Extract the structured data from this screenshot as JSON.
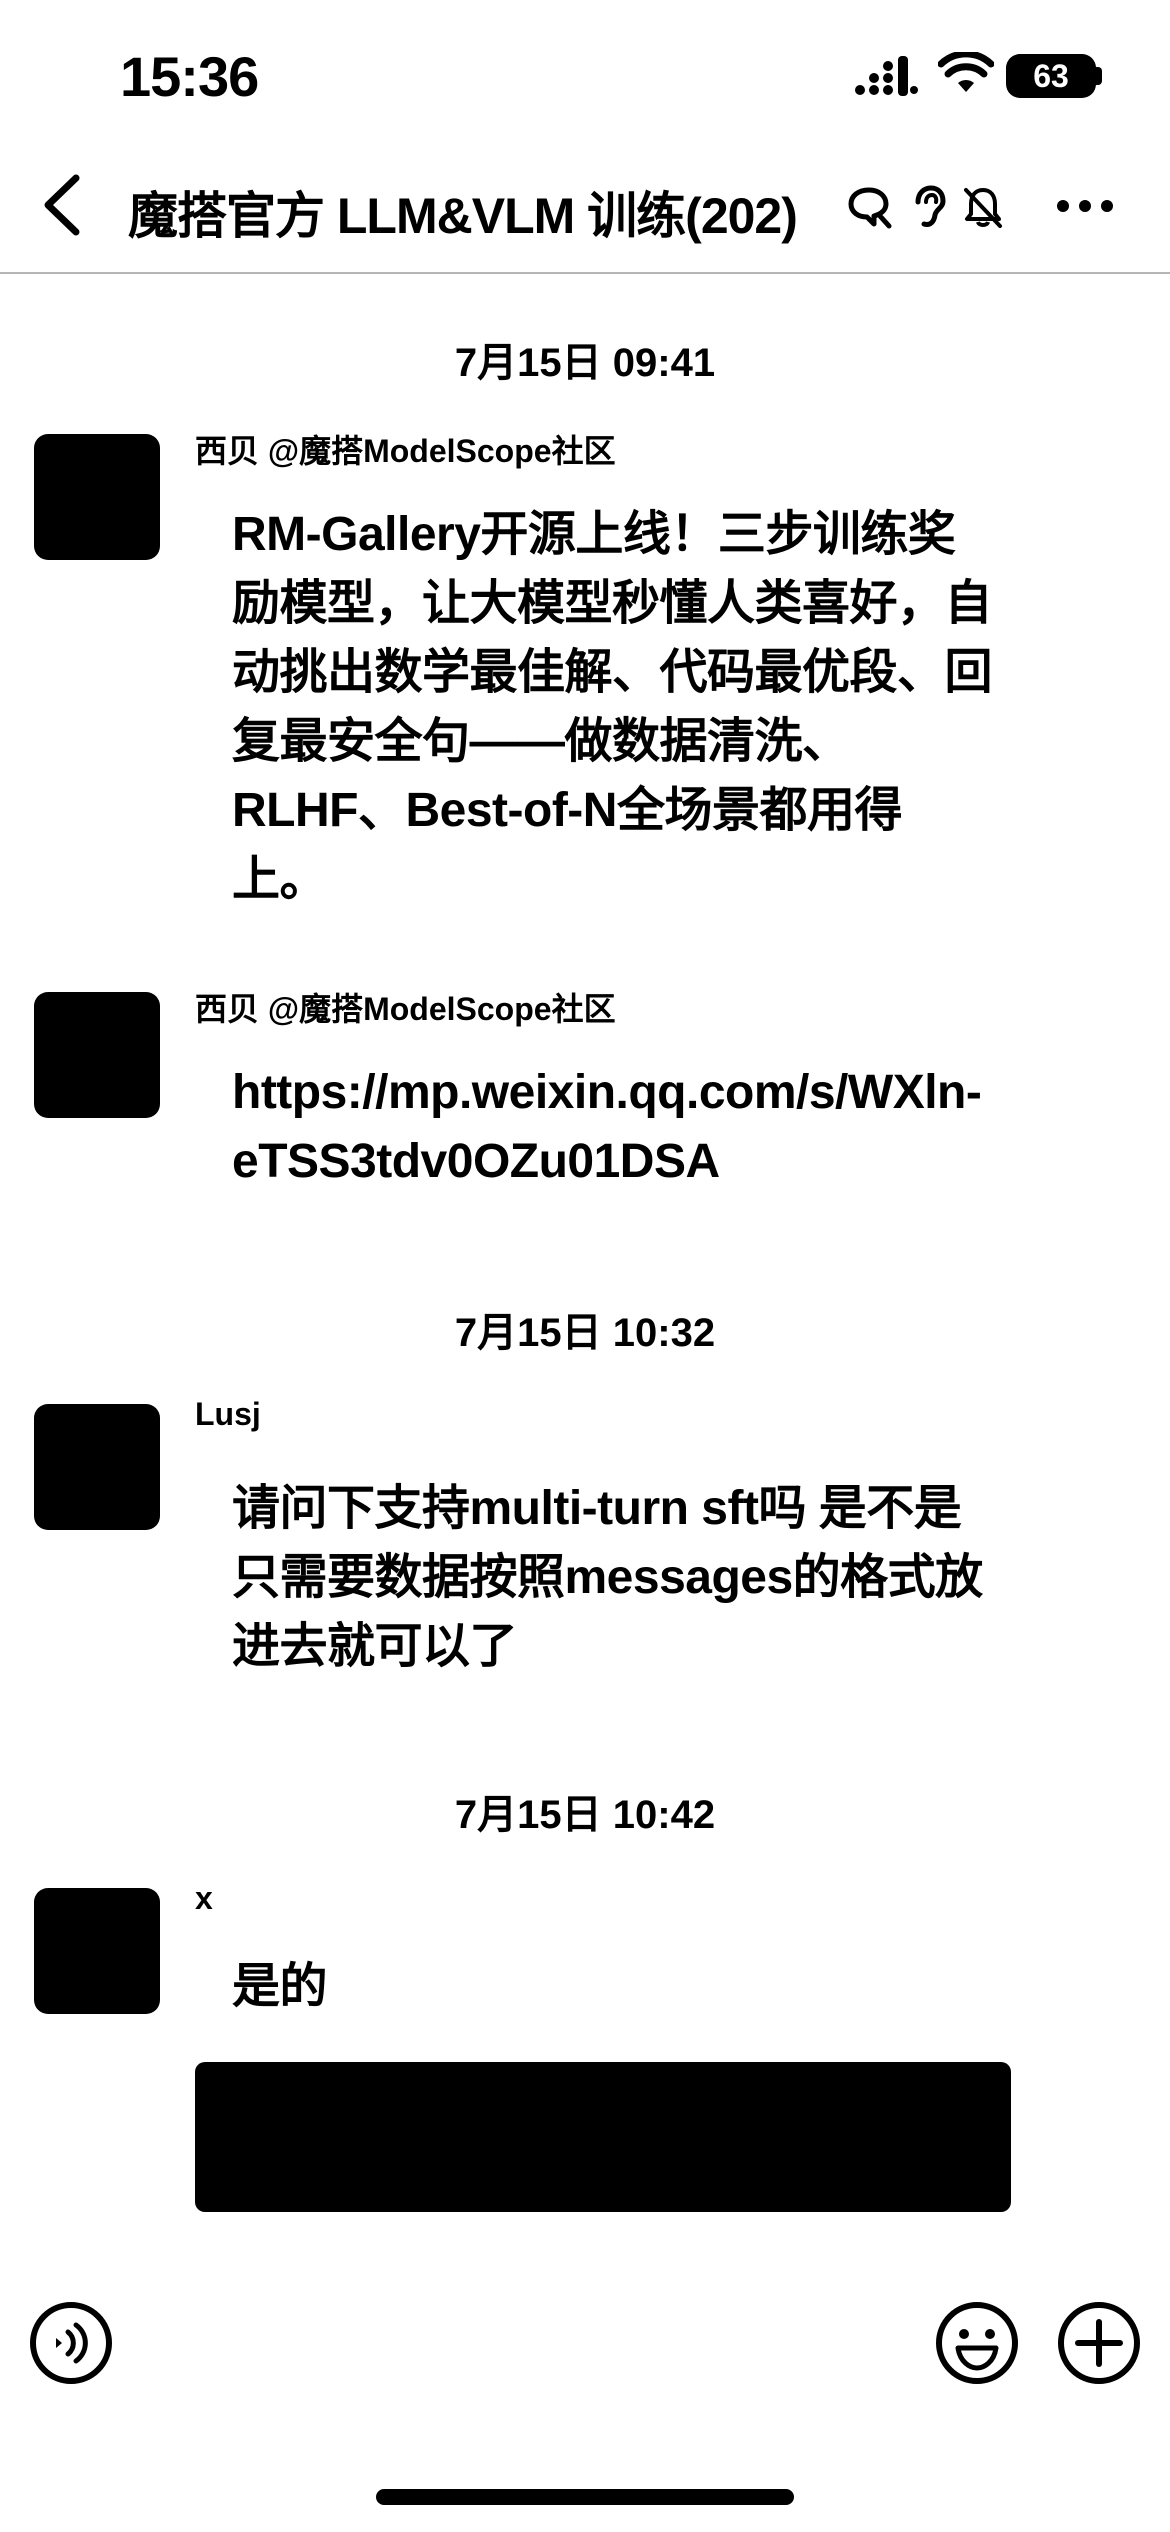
{
  "status_bar": {
    "time": "15:36",
    "battery": "63"
  },
  "header": {
    "title": "魔搭官方 LLM&VLM 训练(202)"
  },
  "messages": [
    {
      "timestamp": "7月15日 09:41",
      "sender": "西贝 @魔搭ModelScope社区",
      "text": "RM-Gallery开源上线！三步训练奖励模型，让大模型秒懂人类喜好，自动挑出数学最佳解、代码最优段、回复最安全句——做数据清洗、RLHF、Best-of-N全场景都用得上。"
    },
    {
      "sender": "西贝 @魔搭ModelScope社区",
      "text": "https://mp.weixin.qq.com/s/WXln-eTSS3tdv0OZu01DSA"
    },
    {
      "timestamp": "7月15日 10:32",
      "sender": "Lusj",
      "text": "请问下支持multi-turn sft吗 是不是只需要数据按照messages的格式放进去就可以了"
    },
    {
      "timestamp": "7月15日 10:42",
      "sender": "x",
      "text": "是的"
    }
  ],
  "icons": {
    "back": "chevron-left-icon",
    "search": "search-chat-icon",
    "ear": "ear-icon",
    "mute": "bell-slash-icon",
    "more": "more-dots-icon",
    "voice": "voice-input-icon",
    "emoji": "emoji-icon",
    "add": "plus-circle-icon"
  }
}
